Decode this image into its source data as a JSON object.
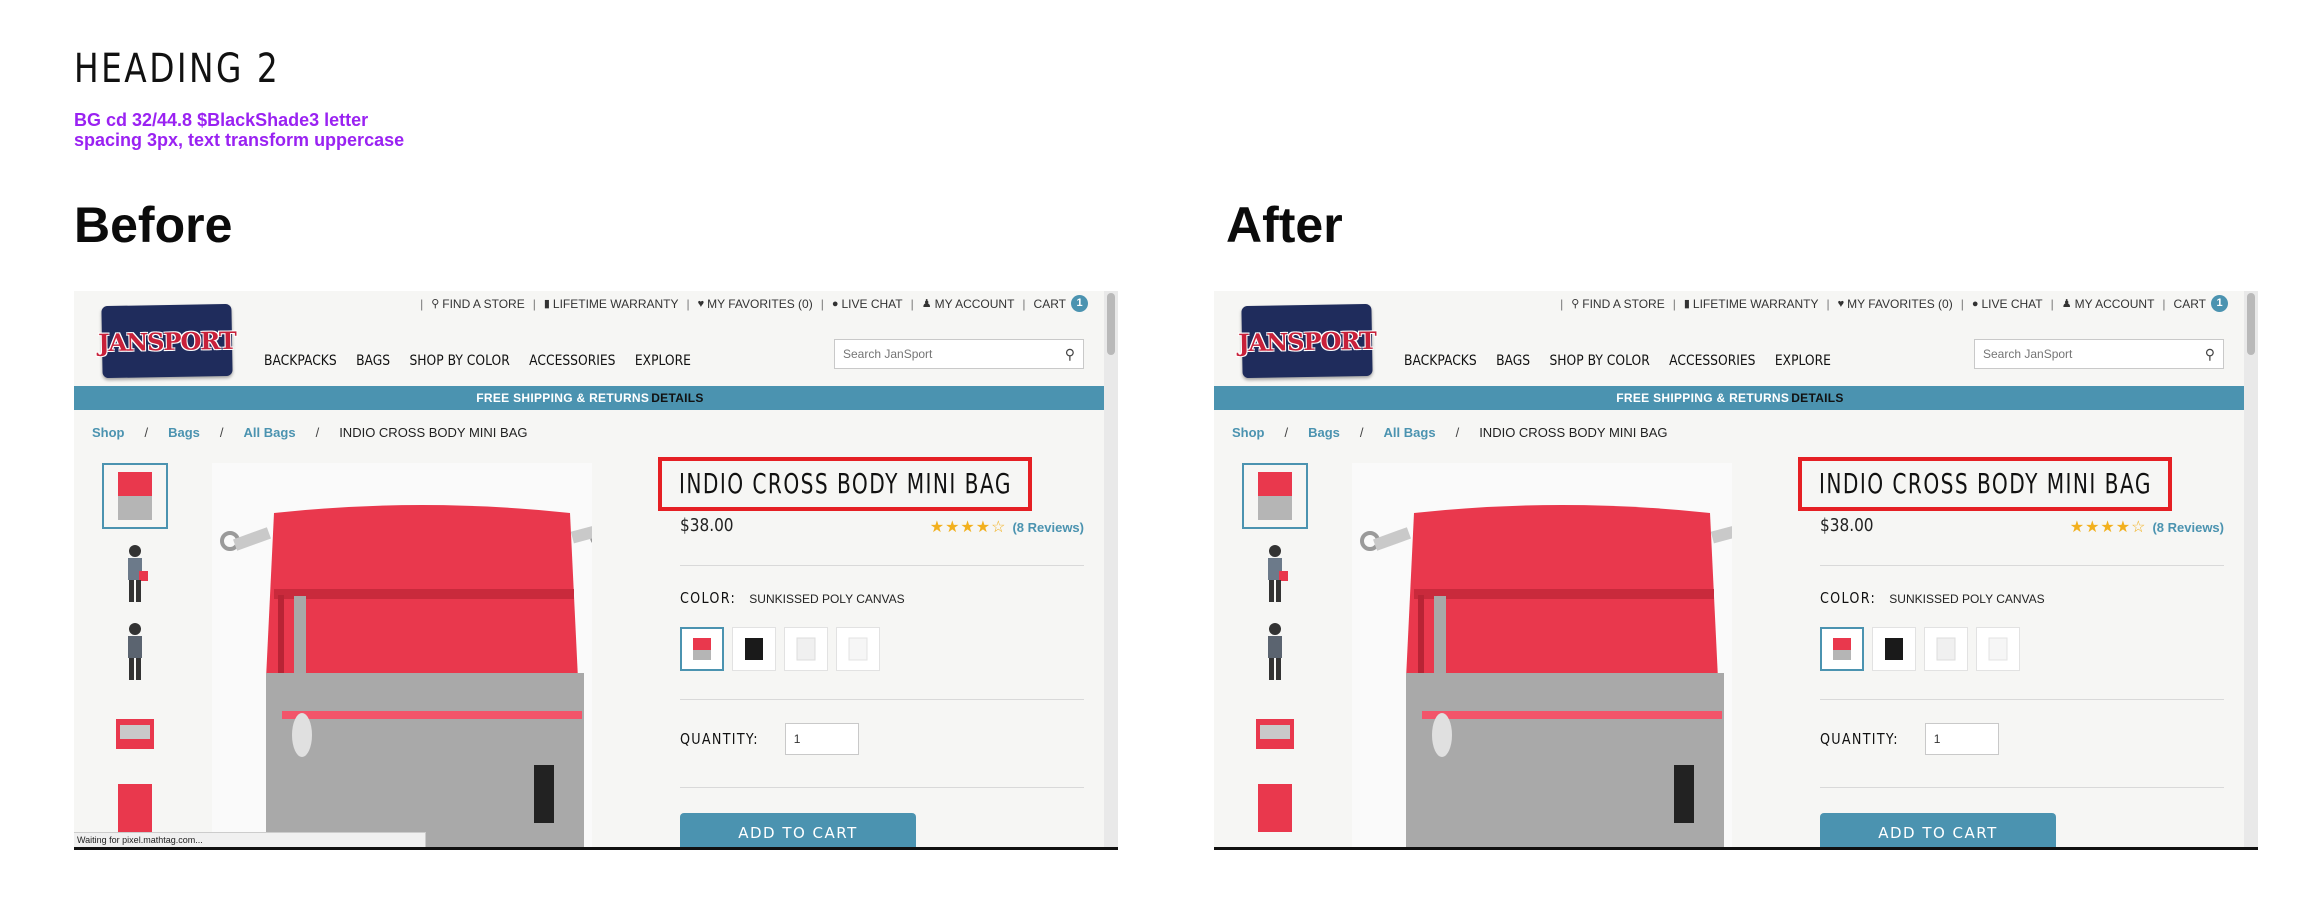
{
  "doc": {
    "heading": "HEADING 2",
    "note": "BG cd 32/44.8 $BlackShade3 letter spacing 3px, text transform uppercase",
    "before_label": "Before",
    "after_label": "After"
  },
  "site": {
    "util": {
      "find_store": "FIND A STORE",
      "warranty": "LIFETIME WARRANTY",
      "favorites": "MY FAVORITES (0)",
      "chat": "LIVE CHAT",
      "account": "MY ACCOUNT",
      "cart": "CART",
      "cart_count": "1"
    },
    "logo": "JANSPORT",
    "nav": [
      "BACKPACKS",
      "BAGS",
      "SHOP BY COLOR",
      "ACCESSORIES",
      "EXPLORE"
    ],
    "search_placeholder": "Search JanSport",
    "promo": "FREE SHIPPING & RETURNS",
    "promo_link": "DETAILS",
    "breadcrumb": {
      "shop": "Shop",
      "bags": "Bags",
      "all_bags": "All Bags",
      "current": "INDIO CROSS BODY MINI BAG"
    },
    "product": {
      "title": "INDIO CROSS BODY MINI BAG",
      "price": "$38.00",
      "rating": 4.5,
      "reviews": "(8 Reviews)",
      "color_label": "COLOR:",
      "color_value": "SUNKISSED POLY CANVAS",
      "qty_label": "QUANTITY:",
      "qty_value": "1",
      "add_to_cart": "ADD TO CART"
    },
    "status_before": "Waiting for pixel.mathtag.com..."
  },
  "colors": {
    "accent": "#4b93b0",
    "highlight": "#e51f24",
    "note": "#9a22f2",
    "star": "#f2b01e",
    "bag_red": "#e9384d",
    "bag_gray": "#a9a9a9"
  }
}
